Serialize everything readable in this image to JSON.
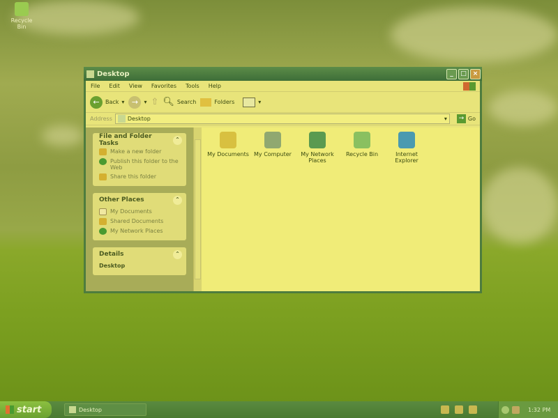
{
  "desktop": {
    "icons": [
      {
        "label": "Recycle Bin"
      }
    ]
  },
  "window": {
    "title": "Desktop",
    "menu": [
      "File",
      "Edit",
      "View",
      "Favorites",
      "Tools",
      "Help"
    ],
    "toolbar": {
      "back": "Back",
      "search": "Search",
      "folders": "Folders"
    },
    "address": {
      "label": "Address",
      "value": "Desktop",
      "go": "Go"
    },
    "panels": [
      {
        "title": "File and Folder Tasks",
        "items": [
          "Make a new folder",
          "Publish this folder to the Web",
          "Share this folder"
        ]
      },
      {
        "title": "Other Places",
        "items": [
          "My Documents",
          "Shared Documents",
          "My Network Places"
        ]
      },
      {
        "title": "Details",
        "subtitle": "Desktop"
      }
    ],
    "files": [
      {
        "label": "My Documents",
        "color": "#d8c040"
      },
      {
        "label": "My Computer",
        "color": "#90a870"
      },
      {
        "label": "My Network Places",
        "color": "#5a9a50"
      },
      {
        "label": "Recycle Bin",
        "color": "#8ac060"
      },
      {
        "label": "Internet Explorer",
        "color": "#4a9ab0"
      }
    ]
  },
  "taskbar": {
    "start": "start",
    "task": "Desktop",
    "clock": "1:32 PM"
  }
}
